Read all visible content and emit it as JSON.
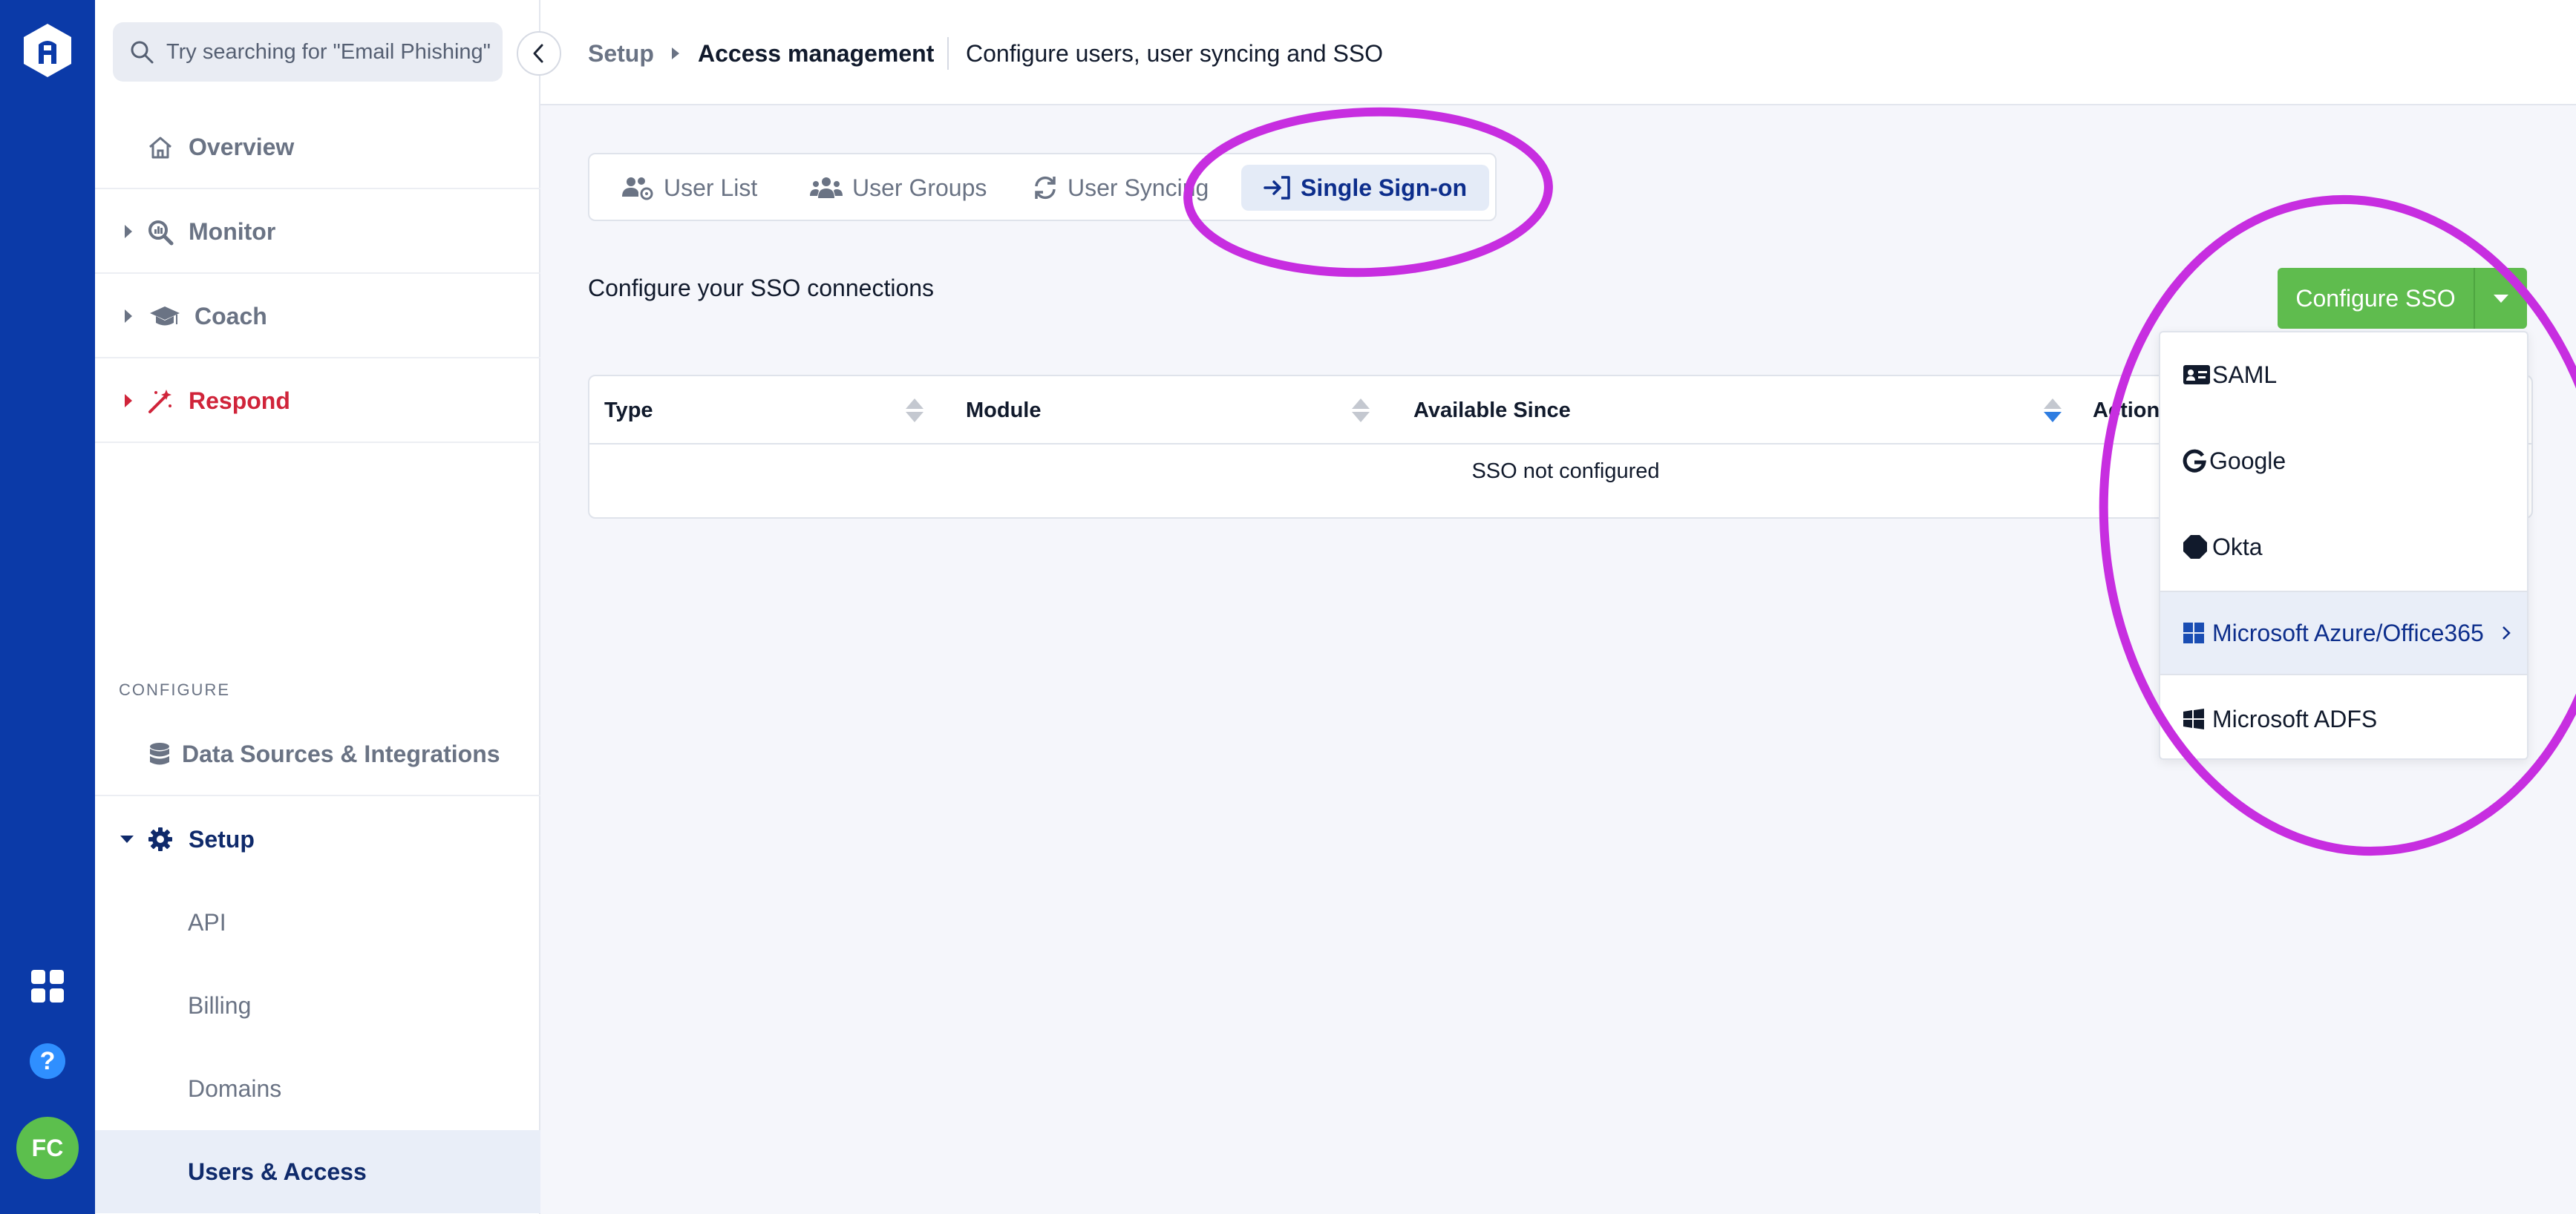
{
  "rail": {
    "logo_icon": "hexagon-logo-icon",
    "apps_icon": "grid-icon",
    "help_label": "?",
    "avatar_initials": "FC"
  },
  "sidebar": {
    "search_placeholder": "Try searching for \"Email Phishing\"",
    "items": [
      {
        "label": "Overview",
        "icon": "home-icon"
      },
      {
        "label": "Monitor",
        "icon": "magnifier-chart-icon"
      },
      {
        "label": "Coach",
        "icon": "graduation-cap-icon"
      },
      {
        "label": "Respond",
        "icon": "magic-wand-icon"
      }
    ],
    "section_label": "CONFIGURE",
    "data_sources_label": "Data Sources & Integrations",
    "setup_label": "Setup",
    "setup_children": [
      "API",
      "Billing",
      "Domains",
      "Users & Access"
    ],
    "colors": {
      "respond": "#d0243a",
      "active_bg": "#e9eef8"
    }
  },
  "header": {
    "crumb_root": "Setup",
    "crumb_page": "Access management",
    "description": "Configure users, user syncing and SSO"
  },
  "tabs": [
    {
      "label": "User List",
      "icon": "users-gear-icon"
    },
    {
      "label": "User Groups",
      "icon": "users-icon"
    },
    {
      "label": "User Syncing",
      "icon": "sync-icon"
    },
    {
      "label": "Single Sign-on",
      "icon": "sign-in-icon",
      "active": true
    }
  ],
  "intro": "Configure your SSO connections",
  "configure_button": {
    "label": "Configure SSO",
    "color": "#5fbc4e"
  },
  "sso_menu": [
    {
      "label": "SAML",
      "icon": "id-card-icon"
    },
    {
      "label": "Google",
      "icon": "google-icon"
    },
    {
      "label": "Okta",
      "icon": "okta-icon"
    },
    {
      "label": "Microsoft Azure/Office365",
      "icon": "windows-icon",
      "highlighted": true,
      "has_submenu": true
    },
    {
      "label": "Microsoft ADFS",
      "icon": "windows-icon"
    }
  ],
  "table": {
    "columns": [
      "Type",
      "Module",
      "Available Since",
      "Actions"
    ],
    "empty_text": "SSO not configured"
  },
  "annotation_color": "#c72ee0"
}
